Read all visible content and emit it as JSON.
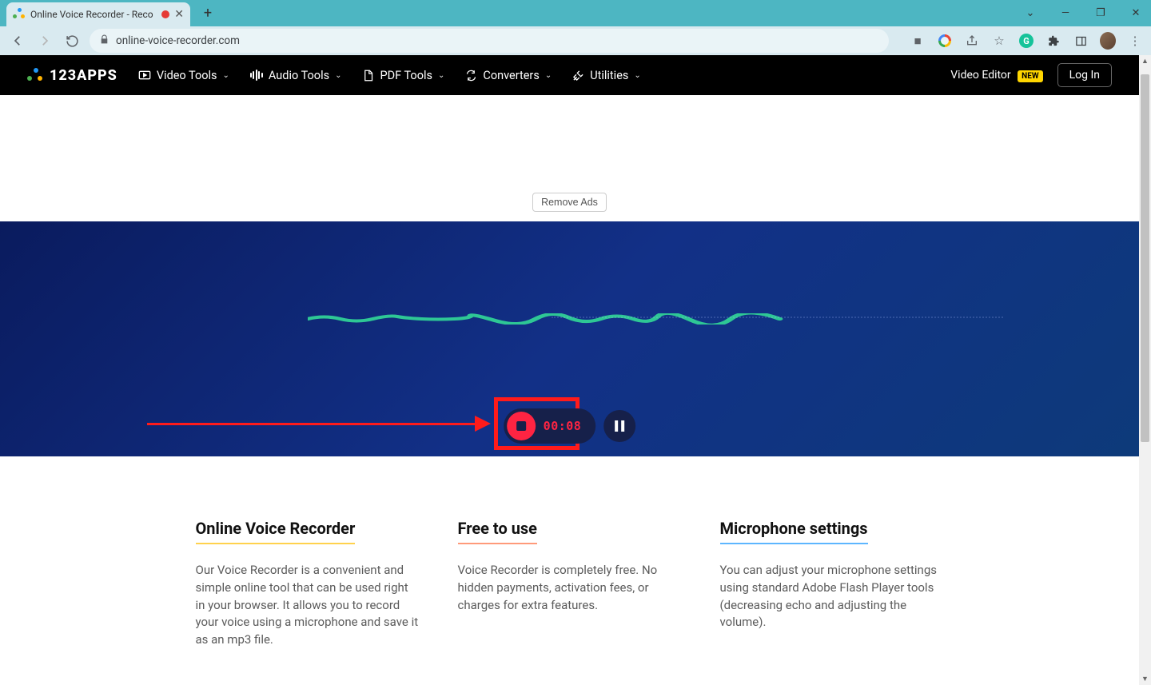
{
  "browser": {
    "tab_title": "Online Voice Recorder - Reco",
    "url": "online-voice-recorder.com"
  },
  "header": {
    "brand": "123APPS",
    "menu": [
      {
        "label": "Video Tools"
      },
      {
        "label": "Audio Tools"
      },
      {
        "label": "PDF Tools"
      },
      {
        "label": "Converters"
      },
      {
        "label": "Utilities"
      }
    ],
    "video_editor": "Video Editor",
    "new_badge": "NEW",
    "login": "Log In"
  },
  "remove_ads": "Remove Ads",
  "recorder": {
    "timer": "00:08"
  },
  "features": [
    {
      "title": "Online Voice Recorder",
      "body": "Our Voice Recorder is a convenient and simple online tool that can be used right in your browser. It allows you to record your voice using a microphone and save it as an mp3 file."
    },
    {
      "title": "Free to use",
      "body": "Voice Recorder is completely free. No hidden payments, activation fees, or charges for extra features."
    },
    {
      "title": "Microphone settings",
      "body": "You can adjust your microphone settings using standard Adobe Flash Player tools (decreasing echo and adjusting the volume)."
    }
  ]
}
